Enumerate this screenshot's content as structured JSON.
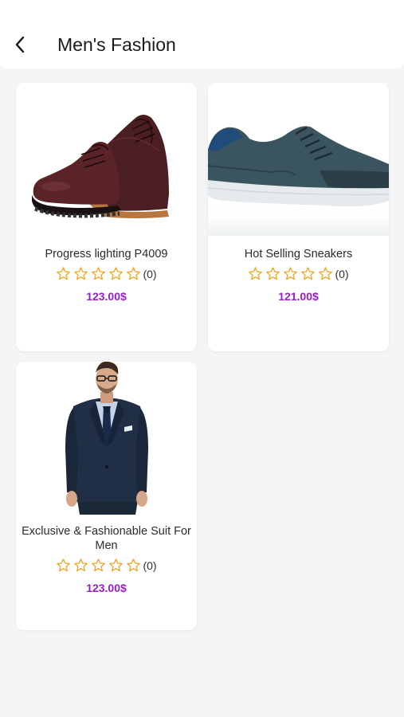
{
  "header": {
    "title": "Men's Fashion",
    "back_icon": "chevron-left-icon"
  },
  "colors": {
    "price": "#9a1bd0",
    "star": "#f2a31b",
    "background": "#f5f5f5",
    "card": "#ffffff"
  },
  "products": [
    {
      "name": "Progress lighting P4009",
      "rating_count": "(0)",
      "stars": 0,
      "price": "123.00$",
      "image_icon": "dress-shoes-image"
    },
    {
      "name": "Hot Selling Sneakers",
      "rating_count": "(0)",
      "stars": 0,
      "price": "121.00$",
      "image_icon": "sneaker-image"
    },
    {
      "name": "Exclusive & Fashionable Suit For Men",
      "rating_count": "(0)",
      "stars": 0,
      "price": "123.00$",
      "image_icon": "suit-image"
    }
  ]
}
